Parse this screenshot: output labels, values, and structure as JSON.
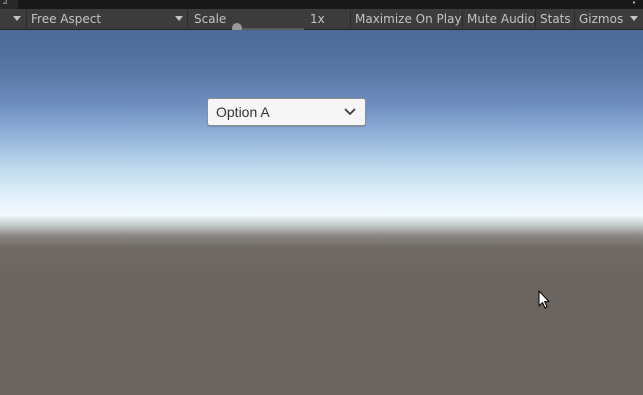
{
  "toolbar": {
    "aspect": "Free Aspect",
    "scale_label": "Scale",
    "scale_value": "1x",
    "scale_slider_value": 0,
    "maximize_on_play": "Maximize On Play",
    "mute_audio": "Mute Audio",
    "stats": "Stats",
    "gizmos": "Gizmos"
  },
  "game": {
    "dropdown": {
      "selected": "Option A"
    }
  },
  "icons": {
    "display_menu": "chevron-down-icon",
    "aspect_menu": "chevron-down-icon",
    "gizmos_menu": "chevron-down-icon",
    "dropdown_arrow": "chevron-down-icon",
    "more_options": "more-dots-icon",
    "cursor": "mouse-cursor-icon"
  },
  "colors": {
    "toolbar_bg": "#3c3c3c",
    "toolbar_text": "#c4c4c4",
    "sky_top": "#4d6a98",
    "horizon": "#f2fbfe",
    "ground": "#6c655f",
    "dropdown_bg": "#f6f6f6"
  }
}
